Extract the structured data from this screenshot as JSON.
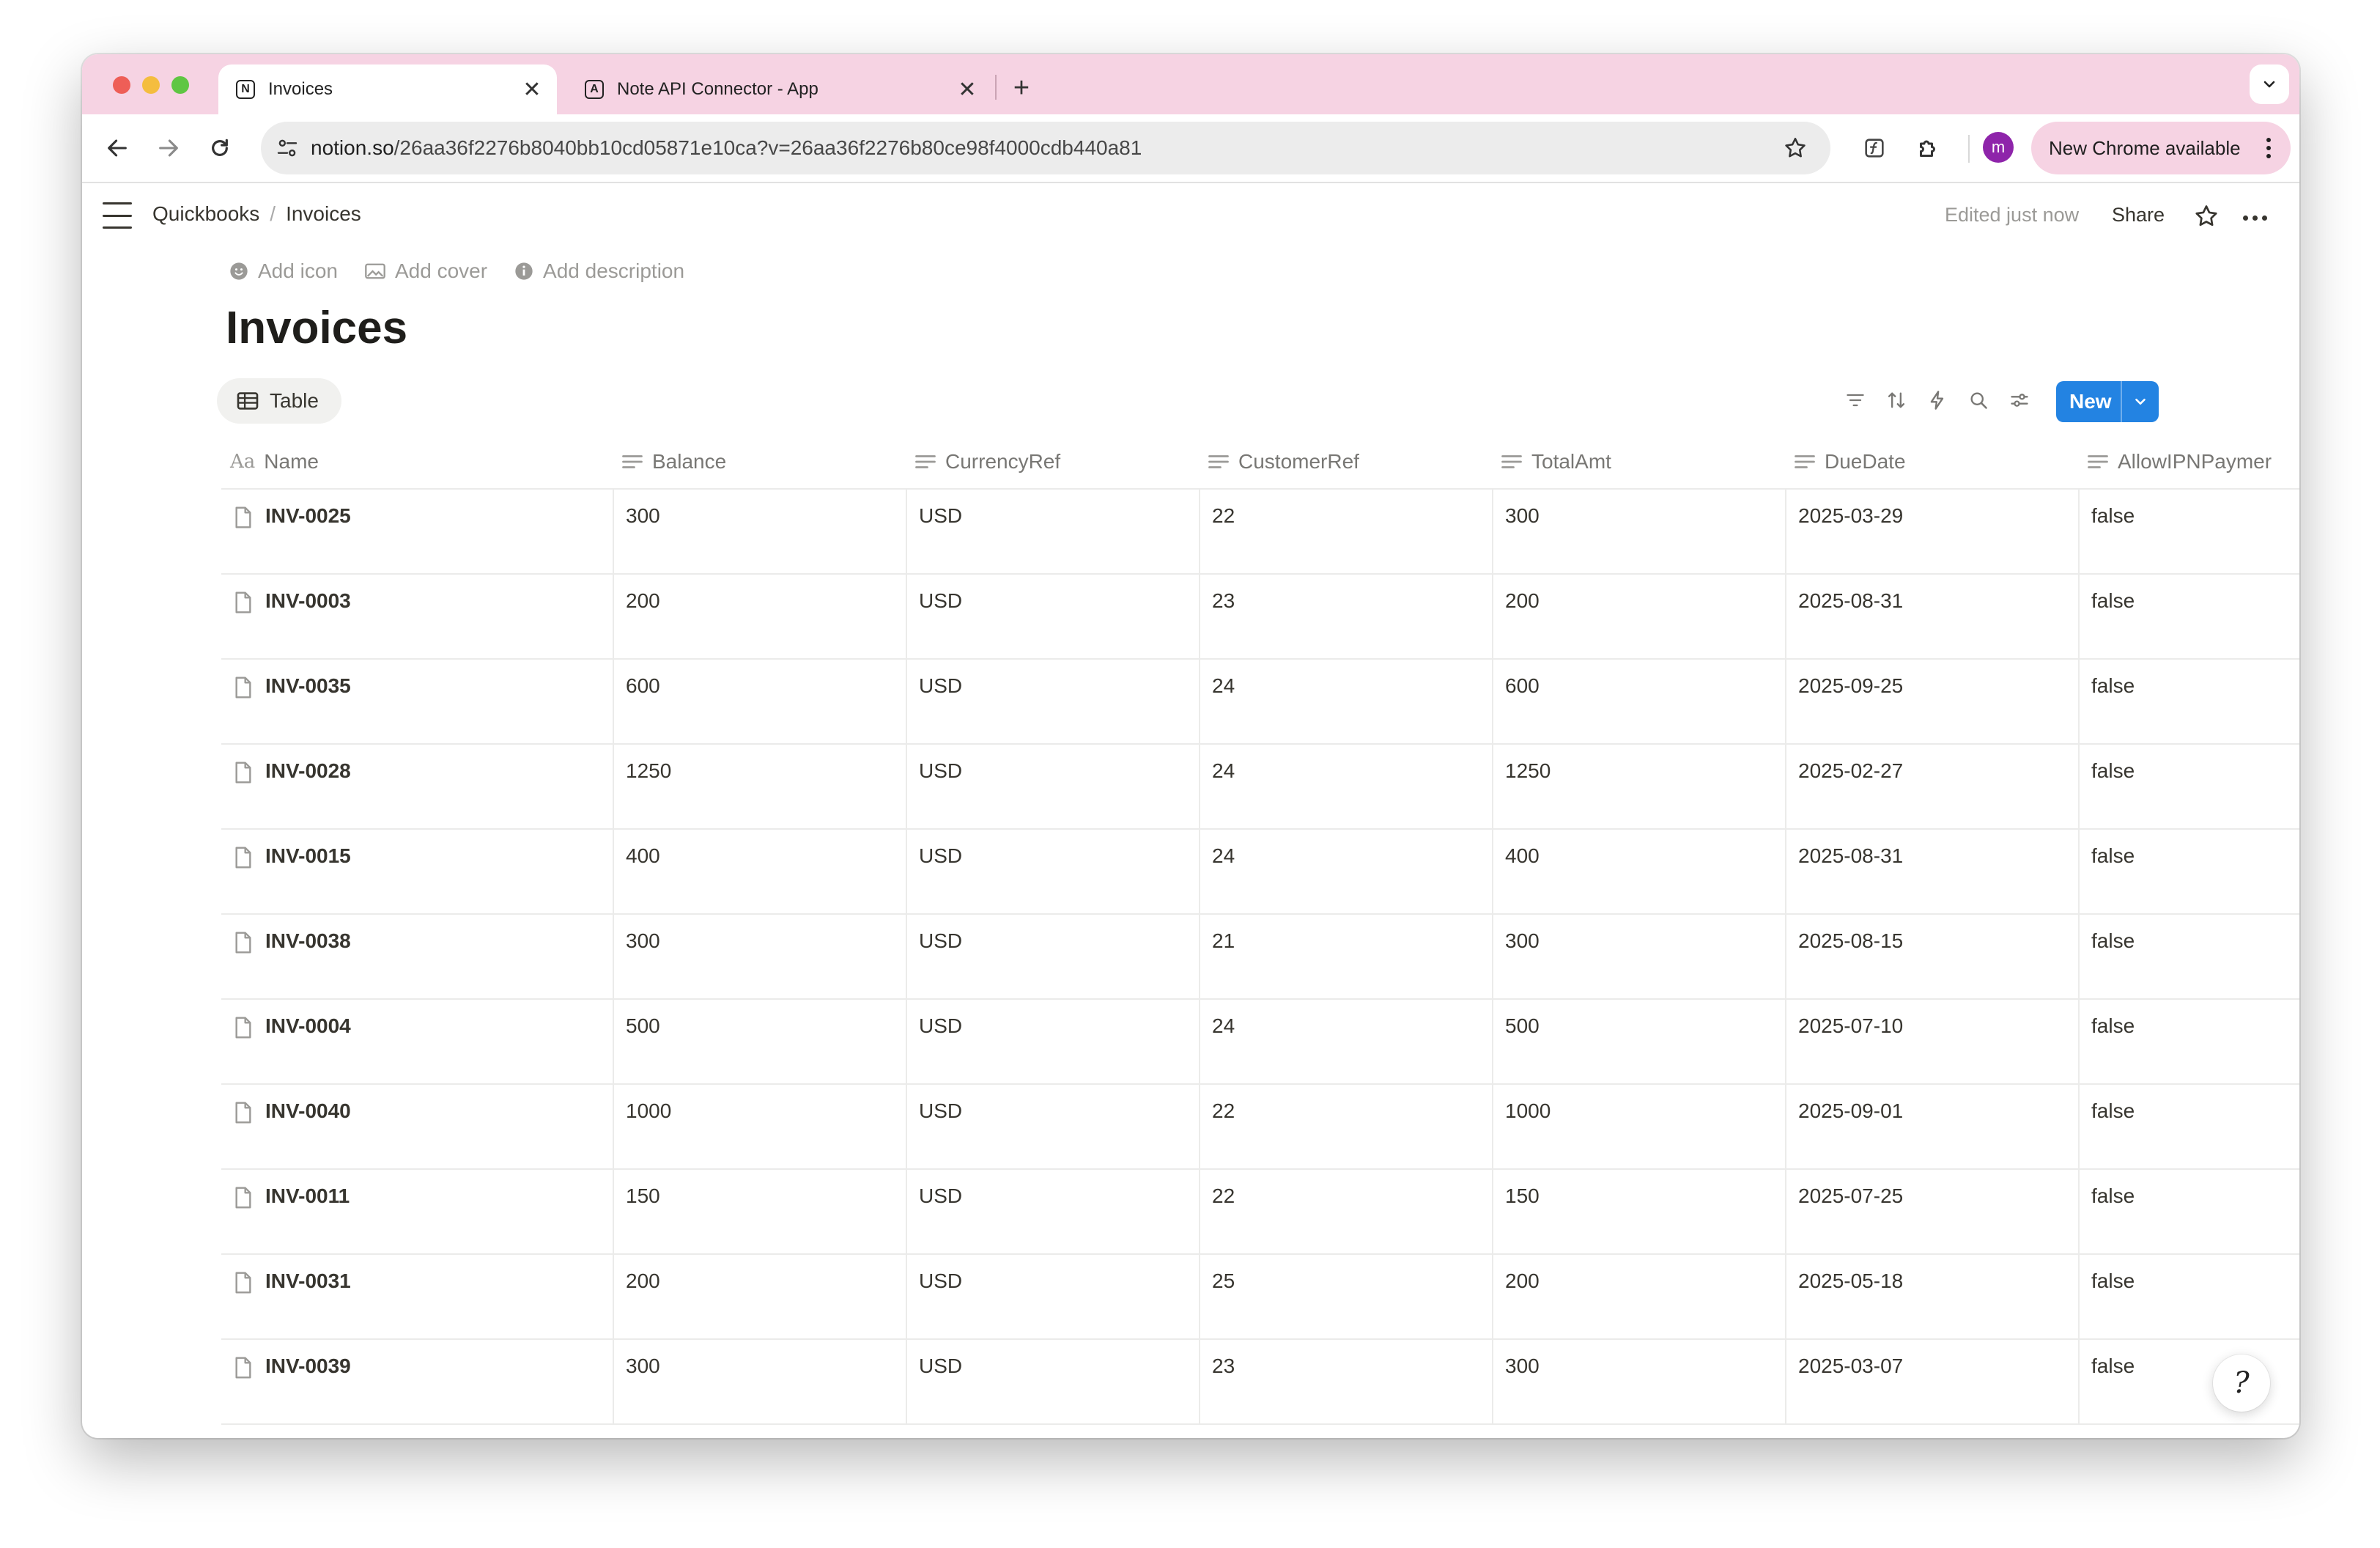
{
  "browser": {
    "tabs": [
      {
        "label": "Invoices",
        "favicon": "N",
        "close": "✕",
        "active": true
      },
      {
        "label": "Note API Connector - App",
        "favicon": "A",
        "close": "✕",
        "active": false
      }
    ],
    "new_tab": "+",
    "url_host": "notion.so",
    "url_rest": "/26aa36f2276b8040bb10cd05871e10ca?v=26aa36f2276b80ce98f4000cdb440a81",
    "profile_initial": "m",
    "update_label": "New Chrome available",
    "tabstrip_color": "#f6d3e3"
  },
  "topbar": {
    "breadcrumb": [
      "Quickbooks",
      "Invoices"
    ],
    "breadcrumb_sep": "/",
    "edited": "Edited just now",
    "share": "Share"
  },
  "page": {
    "actions": [
      "Add icon",
      "Add cover",
      "Add description"
    ],
    "title": "Invoices",
    "view_tab": "Table",
    "new_button": "New",
    "accent": "#2383e2"
  },
  "table": {
    "name_header_prefix": "Aa",
    "columns": [
      "Name",
      "Balance",
      "CurrencyRef",
      "CustomerRef",
      "TotalAmt",
      "DueDate",
      "AllowIPNPaymer"
    ],
    "rows": [
      {
        "name": "INV-0025",
        "balance": "300",
        "currency": "USD",
        "customer": "22",
        "total": "300",
        "due": "2025-03-29",
        "allow": "false"
      },
      {
        "name": "INV-0003",
        "balance": "200",
        "currency": "USD",
        "customer": "23",
        "total": "200",
        "due": "2025-08-31",
        "allow": "false"
      },
      {
        "name": "INV-0035",
        "balance": "600",
        "currency": "USD",
        "customer": "24",
        "total": "600",
        "due": "2025-09-25",
        "allow": "false"
      },
      {
        "name": "INV-0028",
        "balance": "1250",
        "currency": "USD",
        "customer": "24",
        "total": "1250",
        "due": "2025-02-27",
        "allow": "false"
      },
      {
        "name": "INV-0015",
        "balance": "400",
        "currency": "USD",
        "customer": "24",
        "total": "400",
        "due": "2025-08-31",
        "allow": "false"
      },
      {
        "name": "INV-0038",
        "balance": "300",
        "currency": "USD",
        "customer": "21",
        "total": "300",
        "due": "2025-08-15",
        "allow": "false"
      },
      {
        "name": "INV-0004",
        "balance": "500",
        "currency": "USD",
        "customer": "24",
        "total": "500",
        "due": "2025-07-10",
        "allow": "false"
      },
      {
        "name": "INV-0040",
        "balance": "1000",
        "currency": "USD",
        "customer": "22",
        "total": "1000",
        "due": "2025-09-01",
        "allow": "false"
      },
      {
        "name": "INV-0011",
        "balance": "150",
        "currency": "USD",
        "customer": "22",
        "total": "150",
        "due": "2025-07-25",
        "allow": "false"
      },
      {
        "name": "INV-0031",
        "balance": "200",
        "currency": "USD",
        "customer": "25",
        "total": "200",
        "due": "2025-05-18",
        "allow": "false"
      },
      {
        "name": "INV-0039",
        "balance": "300",
        "currency": "USD",
        "customer": "23",
        "total": "300",
        "due": "2025-03-07",
        "allow": "false"
      }
    ]
  },
  "help_glyph": "?"
}
